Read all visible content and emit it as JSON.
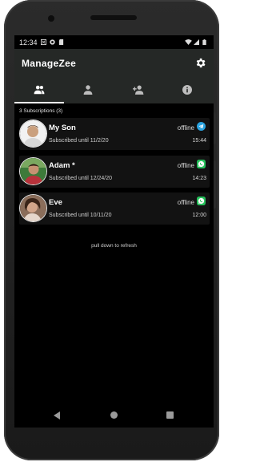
{
  "status_bar": {
    "time": "12:34",
    "icons": [
      "notification-icon",
      "app-icon",
      "sd-card-icon",
      "wifi-icon",
      "signal-icon",
      "battery-icon"
    ]
  },
  "app": {
    "title": "ManageZee",
    "accent": "#252826"
  },
  "tabs": [
    {
      "name": "subscriptions",
      "icon": "people-icon",
      "active": true
    },
    {
      "name": "profile",
      "icon": "person-icon",
      "active": false
    },
    {
      "name": "add-person",
      "icon": "person-add-icon",
      "active": false
    },
    {
      "name": "info",
      "icon": "info-icon",
      "active": false
    }
  ],
  "subscriptions_label": "3 Subscriptions (3)",
  "contacts": [
    {
      "name": "My Son",
      "until": "Subscribed until 11/2/20",
      "status": "offline",
      "time": "15:44",
      "messenger": "telegram-icon",
      "messenger_color": "#2aa3e0"
    },
    {
      "name": "Adam *",
      "until": "Subscribed until 12/24/20",
      "status": "offline",
      "time": "14:23",
      "messenger": "whatsapp-icon",
      "messenger_color": "#25c05a"
    },
    {
      "name": "Eve",
      "until": "Subscribed until 10/11/20",
      "status": "offline",
      "time": "12:00",
      "messenger": "whatsapp-icon",
      "messenger_color": "#25c05a"
    }
  ],
  "pull_hint": "pull down to refresh"
}
